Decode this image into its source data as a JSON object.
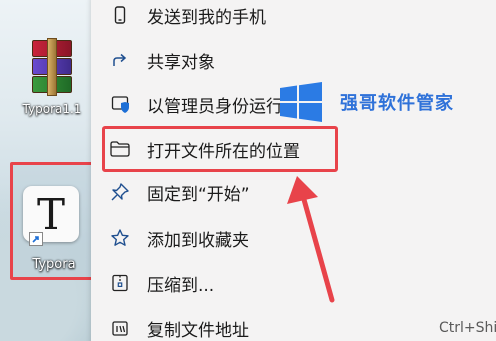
{
  "desktop": {
    "winrar_label": "Typora1.1",
    "typora_label": "Typora",
    "typora_glyph": "T"
  },
  "menu": {
    "items": [
      {
        "label": "发送到我的手机",
        "icon": "phone-icon"
      },
      {
        "label": "共享对象",
        "icon": "share-icon"
      },
      {
        "label": "以管理员身份运行",
        "icon": "shield-icon"
      },
      {
        "label": "打开文件所在的位置",
        "icon": "folder-icon"
      },
      {
        "label": "固定到“开始”",
        "icon": "pin-icon"
      },
      {
        "label": "添加到收藏夹",
        "icon": "star-icon"
      },
      {
        "label": "压缩到...",
        "icon": "zip-icon"
      },
      {
        "label": "复制文件地址",
        "icon": "copy-path-icon",
        "shortcut": "Ctrl+Shi"
      }
    ]
  },
  "watermark": {
    "text": "强哥软件管家",
    "logo": "windows-logo-icon"
  },
  "colors": {
    "highlight": "#e8434a",
    "watermark": "#2f72d9",
    "menu_bg": "#f4f3f3",
    "icon_stroke": "#1f4f8f"
  }
}
